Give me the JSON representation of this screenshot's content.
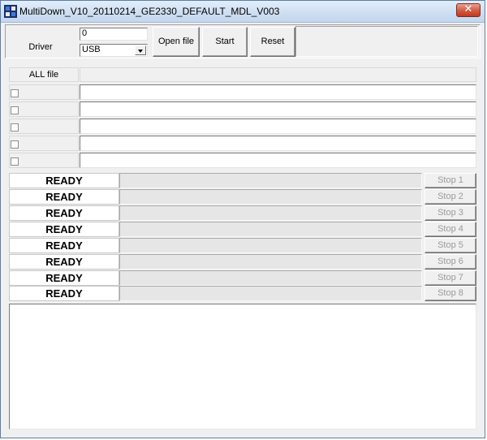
{
  "window": {
    "title": "MultiDown_V10_20110214_GE2330_DEFAULT_MDL_V003",
    "close_glyph": "✕"
  },
  "top_panel": {
    "driver_label": "Driver",
    "count_value": "0",
    "driver_select": {
      "selected": "USB"
    },
    "buttons": {
      "open_file": "Open file",
      "start": "Start",
      "reset": "Reset"
    }
  },
  "files": {
    "all_file_label": "ALL file",
    "rows": [
      {
        "checked": false,
        "path": ""
      },
      {
        "checked": false,
        "path": ""
      },
      {
        "checked": false,
        "path": ""
      },
      {
        "checked": false,
        "path": ""
      },
      {
        "checked": false,
        "path": ""
      }
    ]
  },
  "ports": [
    {
      "status": "READY",
      "stop_label": "Stop 1",
      "progress": 0
    },
    {
      "status": "READY",
      "stop_label": "Stop 2",
      "progress": 0
    },
    {
      "status": "READY",
      "stop_label": "Stop 3",
      "progress": 0
    },
    {
      "status": "READY",
      "stop_label": "Stop 4",
      "progress": 0
    },
    {
      "status": "READY",
      "stop_label": "Stop 5",
      "progress": 0
    },
    {
      "status": "READY",
      "stop_label": "Stop 6",
      "progress": 0
    },
    {
      "status": "READY",
      "stop_label": "Stop 7",
      "progress": 0
    },
    {
      "status": "READY",
      "stop_label": "Stop 8",
      "progress": 0
    }
  ],
  "log": {
    "text": ""
  }
}
